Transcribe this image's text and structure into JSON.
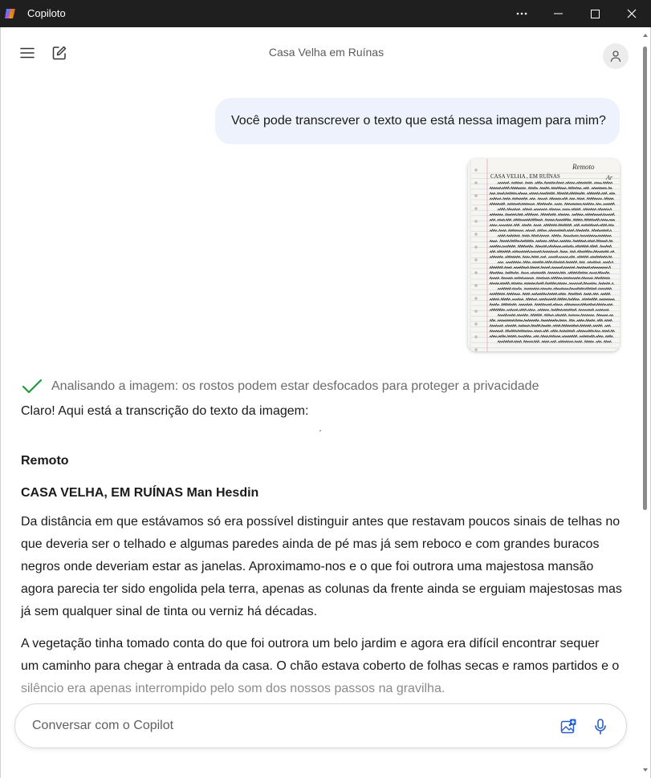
{
  "window": {
    "app_title": "Copiloto",
    "more_icon": "more-horizontal-icon",
    "minimize_icon": "minimize-icon",
    "maximize_icon": "maximize-icon",
    "close_icon": "close-icon"
  },
  "header": {
    "menu_icon": "hamburger-menu-icon",
    "new_chat_icon": "new-chat-icon",
    "title": "Casa Velha em Ruínas",
    "avatar_icon": "user-icon"
  },
  "conversation": {
    "user_message": "Você pode transcrever o texto que está nessa imagem para mim?",
    "attachment": {
      "corner_note_line1": "Remoto",
      "corner_note_line2": "Ar",
      "page_title": "CASA VELHA , EM RUÍNAS"
    },
    "status": {
      "icon": "checkmark-icon",
      "text": "Analisando a imagem: os rostos podem estar desfocados para proteger a privacidade"
    },
    "response": {
      "intro": "Claro! Aqui está a transcrição do texto da imagem:",
      "heading1": "Remoto",
      "heading2": "CASA VELHA, EM RUÍNAS Man Hesdin",
      "paragraph1": "Da distância em que estávamos só era possível distinguir antes que restavam poucos sinais de telhas no que deveria ser o telhado e algumas paredes ainda de pé mas já sem reboco e com grandes buracos negros onde deveriam estar as janelas. Aproximamo-nos e o que foi outrora uma majestosa mansão agora parecia ter sido engolida pela terra, apenas as colunas da frente ainda se erguiam majestosas mas já sem qualquer sinal de tinta ou verniz há décadas.",
      "paragraph2_lines": [
        "A vegetação tinha tomado conta do que foi outrora um belo jardim e agora era difícil encontrar sequer",
        "um caminho para chegar à entrada da casa. O chão estava coberto de folhas secas e ramos partidos e o",
        "silêncio era apenas interrompido pelo som dos nossos passos na gravilha."
      ]
    }
  },
  "composer": {
    "placeholder": "Conversar com o Copilot",
    "image_icon": "add-image-icon",
    "mic_icon": "microphone-icon"
  },
  "colors": {
    "titlebar": "#1f1f1f",
    "user_bubble": "#eef2fd",
    "accent_blue": "#2a5fc9",
    "check_green": "#1e9b3a"
  }
}
